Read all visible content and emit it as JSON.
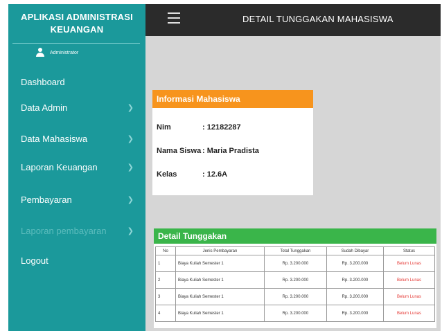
{
  "sidebar": {
    "brand": "APLIKASI ADMINISTRASI KEUANGAN",
    "user": "Administrator",
    "items": [
      {
        "label": "Dashboard",
        "chevron": false,
        "dim": false
      },
      {
        "label": "Data Admin",
        "chevron": true,
        "dim": false
      },
      {
        "label": "Data Mahasiswa",
        "chevron": true,
        "dim": false
      },
      {
        "label": "Laporan Keuangan",
        "chevron": true,
        "dim": false
      },
      {
        "label": "Pembayaran",
        "chevron": true,
        "dim": false
      },
      {
        "label": "Laporan pembayaran",
        "chevron": true,
        "dim": true
      },
      {
        "label": "Logout",
        "chevron": false,
        "dim": false
      }
    ]
  },
  "header": {
    "title": "DETAIL TUNGGAKAN MAHASISWA",
    "menu_icon": "hamburger-icon"
  },
  "info": {
    "title": "Informasi Mahasiswa",
    "nim_label": "Nim",
    "nim_value": ": 12182287",
    "nama_label": "Nama Siswa",
    "nama_value": ": Maria Pradista",
    "kelas_label": "Kelas",
    "kelas_value": ": 12.6A"
  },
  "debt": {
    "title": "Detail Tunggakan",
    "columns": [
      "No",
      "Jenis Pembayaran",
      "Total Tunggakan",
      "Sudah Dibayar",
      "Status"
    ],
    "rows": [
      [
        "1",
        "Biaya Kuliah Semester 1",
        "Rp. 3.200.000",
        "Rp. 3.200.000",
        "Belum Lunas"
      ],
      [
        "2",
        "Biaya Kuliah Semester 1",
        "Rp. 3.200.000",
        "Rp. 3.200.000",
        "Belum Lunas"
      ],
      [
        "3",
        "Biaya Kuliah Semester 1",
        "Rp. 3.200.000",
        "Rp. 3.200.000",
        "Belum Lunas"
      ],
      [
        "4",
        "Biaya Kuliah Semester 1",
        "Rp. 3.200.000",
        "Rp. 3.200.000",
        "Belum Lunas"
      ]
    ]
  },
  "colors": {
    "sidebar": "#1b999b",
    "topbar": "#2b2b2b",
    "info_header": "#f7941d",
    "debt_header": "#3ab54a",
    "status": "#e53935"
  }
}
